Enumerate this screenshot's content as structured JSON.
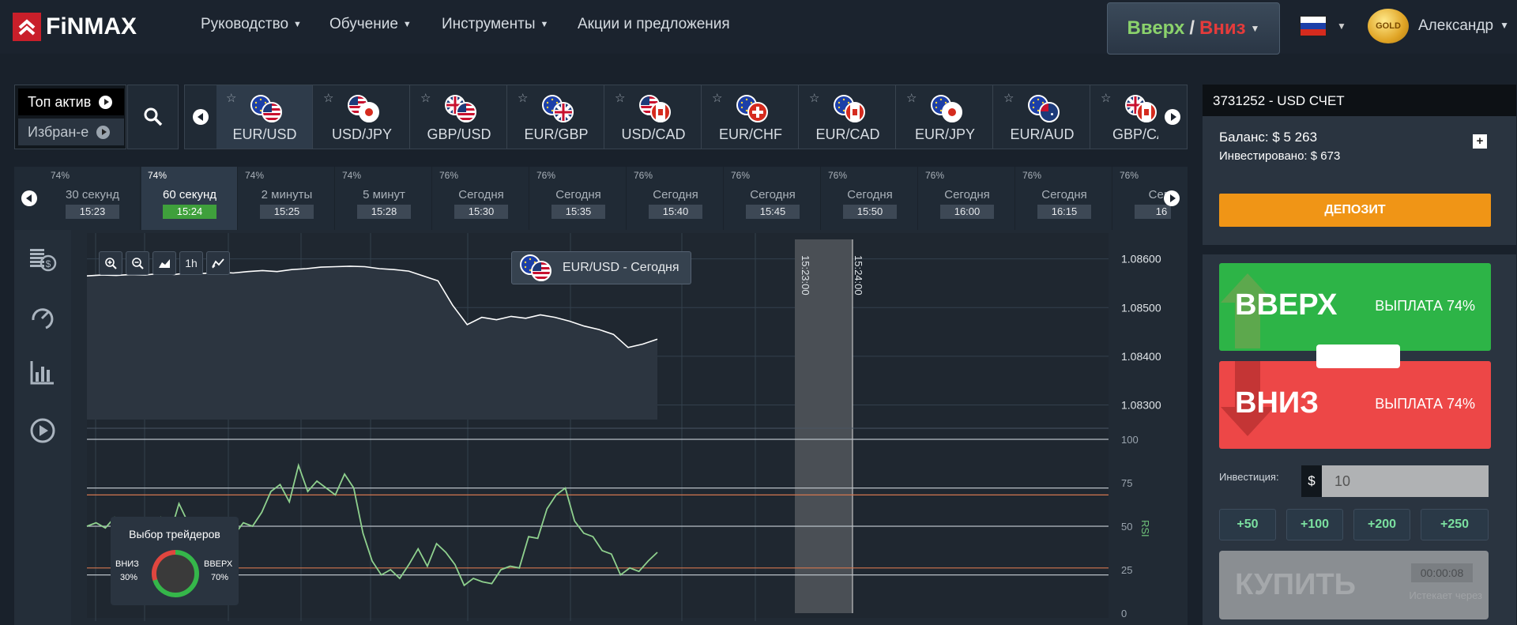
{
  "header": {
    "logo_text": "FiNMAX",
    "nav": [
      "Руководство",
      "Обучение",
      "Инструменты",
      "Акции и предложения"
    ],
    "nav_has_caret": [
      true,
      true,
      true,
      false
    ],
    "mode_up": "Вверх",
    "mode_sep": "/",
    "mode_down": "Вниз",
    "badge": "GOLD",
    "username": "Александр"
  },
  "assets": {
    "top_label": "Топ актив",
    "fav_label": "Избран-е",
    "items": [
      "EUR/USD",
      "USD/JPY",
      "GBP/USD",
      "EUR/GBP",
      "USD/CAD",
      "EUR/CHF",
      "EUR/CAD",
      "EUR/JPY",
      "EUR/AUD",
      "GBP/CAD"
    ],
    "last_visible": "GBP/CA",
    "selected_index": 0
  },
  "expiries": [
    {
      "pct": "74%",
      "label": "30 секунд",
      "time": "15:23"
    },
    {
      "pct": "74%",
      "label": "60 секунд",
      "time": "15:24"
    },
    {
      "pct": "74%",
      "label": "2 минуты",
      "time": "15:25"
    },
    {
      "pct": "74%",
      "label": "5 минут",
      "time": "15:28"
    },
    {
      "pct": "76%",
      "label": "Сегодня",
      "time": "15:30"
    },
    {
      "pct": "76%",
      "label": "Сегодня",
      "time": "15:35"
    },
    {
      "pct": "76%",
      "label": "Сегодня",
      "time": "15:40"
    },
    {
      "pct": "76%",
      "label": "Сегодня",
      "time": "15:45"
    },
    {
      "pct": "76%",
      "label": "Сегодня",
      "time": "15:50"
    },
    {
      "pct": "76%",
      "label": "Сегодня",
      "time": "16:00"
    },
    {
      "pct": "76%",
      "label": "Сегодня",
      "time": "16:15"
    },
    {
      "pct": "76%",
      "label": "Сего",
      "time": "16"
    }
  ],
  "chart": {
    "tip_pair": "EUR/USD",
    "tip_sep": " - ",
    "tip_period": "Сегодня",
    "zoom_timeframe": "1h",
    "expiry_markers": [
      "15:23:00",
      "15:24:00"
    ],
    "price_ticks": [
      "1.08600",
      "1.08500",
      "1.08400",
      "1.08300"
    ],
    "rsi_ticks": [
      "100",
      "75",
      "50",
      "25",
      "0"
    ],
    "rsi_label": "RSI",
    "traders_title": "Выбор трейдеров",
    "down_label": "ВНИЗ",
    "down_pct": "30%",
    "up_label": "ВВЕРХ",
    "up_pct": "70%",
    "down_share": 0.3,
    "up_share": 0.7
  },
  "chart_data": {
    "type": "line",
    "title": "EUR/USD - Сегодня",
    "series": [
      {
        "name": "EUR/USD",
        "values": [
          1.08565,
          1.08567,
          1.08566,
          1.08568,
          1.08567,
          1.0857,
          1.08568,
          1.08572,
          1.0857,
          1.08573,
          1.08571,
          1.08574,
          1.08576,
          1.08574,
          1.08578,
          1.0858,
          1.08583,
          1.08584,
          1.08585,
          1.08584,
          1.0858,
          1.08578,
          1.08575,
          1.08565,
          1.08555,
          1.08505,
          1.08465,
          1.0848,
          1.08475,
          1.08482,
          1.08478,
          1.08485,
          1.0848,
          1.08472,
          1.08462,
          1.08455,
          1.08445,
          1.08418,
          1.08425,
          1.08435
        ]
      }
    ],
    "ylim": [
      1.0827,
      1.0864
    ],
    "rsi": {
      "name": "RSI",
      "ylim": [
        0,
        100
      ],
      "levels": [
        100,
        72,
        68,
        50,
        26,
        22
      ],
      "values": [
        50,
        52,
        49,
        55,
        46,
        52,
        43,
        48,
        55,
        45,
        63,
        52,
        42,
        51,
        49,
        47,
        45,
        52,
        50,
        58,
        70,
        74,
        64,
        85,
        70,
        76,
        72,
        68,
        80,
        72,
        46,
        30,
        22,
        25,
        20,
        28,
        37,
        27,
        40,
        35,
        28,
        16,
        20,
        18,
        17,
        25,
        27,
        26,
        44,
        43,
        60,
        68,
        72,
        53,
        46,
        44,
        36,
        34,
        22,
        26,
        24,
        30,
        35
      ]
    },
    "traders_choice": {
      "down": 30,
      "up": 70
    }
  },
  "account": {
    "title": "3731252 - USD СЧЕТ",
    "balance": "Баланс: $ 5 263",
    "invested": "Инвестировано: $ 673",
    "deposit": "ДЕПОЗИТ"
  },
  "trade": {
    "up_label": "ВВЕРХ",
    "up_payout": "ВЫПЛАТА 74%",
    "down_label": "ВНИЗ",
    "down_payout": "ВЫПЛАТА 74%",
    "investment_label": "Инвестиция:",
    "currency": "$",
    "investment_value": "10",
    "quick_amounts": [
      "+50",
      "+100",
      "+200",
      "+250"
    ],
    "buy_label": "КУПИТЬ",
    "timer": "00:00:08",
    "expires_label": "Истекает через"
  },
  "colors": {
    "up": "#2db447",
    "down": "#ed4747",
    "deposit": "#f09516",
    "rsi_line": "#8fd18e",
    "price_line": "#ffffff"
  }
}
